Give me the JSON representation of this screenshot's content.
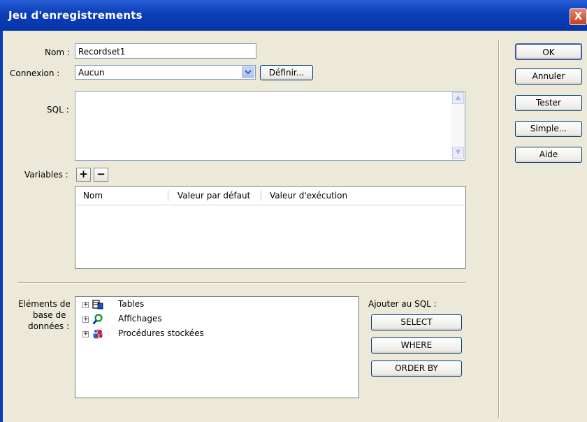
{
  "window": {
    "title": "Jeu d'enregistrements",
    "close_glyph": "X"
  },
  "form": {
    "nom_label": "Nom :",
    "nom_value": "Recordset1",
    "connexion_label": "Connexion :",
    "connexion_value": "Aucun",
    "definir_label": "Définir...",
    "sql_label": "SQL :",
    "sql_value": "",
    "variables_label": "Variables :",
    "add_glyph": "+",
    "remove_glyph": "−"
  },
  "variables_table": {
    "columns": [
      "Nom",
      "Valeur par défaut",
      "Valeur d'exécution"
    ],
    "rows": []
  },
  "db_elements": {
    "label_line1": "Eléments de",
    "label_line2": "base de",
    "label_line3": "données :",
    "items": [
      {
        "label": "Tables",
        "icon": "table-icon"
      },
      {
        "label": "Affichages",
        "icon": "view-icon"
      },
      {
        "label": "Procédures stockées",
        "icon": "stored-procedure-icon"
      }
    ]
  },
  "add_to_sql": {
    "label": "Ajouter au SQL :",
    "select": "SELECT",
    "where": "WHERE",
    "order_by": "ORDER BY"
  },
  "side_buttons": {
    "ok": "OK",
    "annuler": "Annuler",
    "tester": "Tester",
    "simple": "Simple...",
    "aide": "Aide"
  }
}
